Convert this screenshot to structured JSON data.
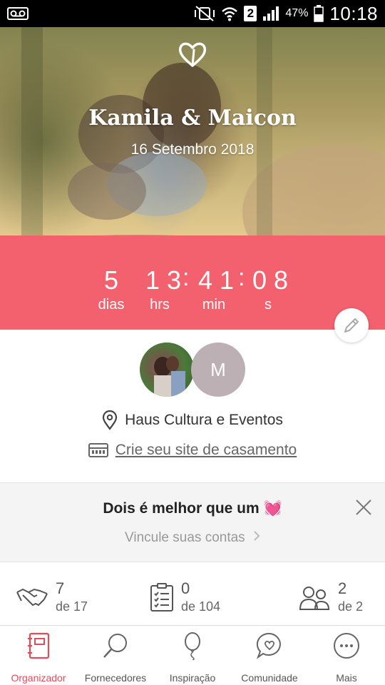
{
  "status_bar": {
    "battery": "47%",
    "sim": "2",
    "time": "10:18",
    "icons": [
      "voicemail-icon",
      "vibrate-off-icon",
      "wifi-icon",
      "signal-icon",
      "battery-icon"
    ]
  },
  "hero": {
    "names": "Kamila & Maicon",
    "date": "16 Setembro 2018",
    "heart_icon": "heart-outline-icon"
  },
  "countdown": {
    "days": "5",
    "hours": "13",
    "minutes": "41",
    "seconds": "08",
    "separator": ":",
    "labels": {
      "days": "dias",
      "hours": "hrs",
      "minutes": "min",
      "seconds": "s"
    },
    "color": "#f2616d"
  },
  "couple": {
    "avatar_letter": "M",
    "venue": "Haus Cultura e Eventos",
    "site_link": "Crie seu site de casamento"
  },
  "promo": {
    "title": "Dois é melhor que um 💓",
    "link": "Vincule suas contas"
  },
  "stats": [
    {
      "icon": "handshake-icon",
      "value": "7",
      "total": "de 17"
    },
    {
      "icon": "checklist-icon",
      "value": "0",
      "total": "de 104"
    },
    {
      "icon": "guests-icon",
      "value": "2",
      "total": "de 2"
    }
  ],
  "nav": {
    "items": [
      {
        "label": "Organizador",
        "icon": "organizer-icon",
        "active": true
      },
      {
        "label": "Fornecedores",
        "icon": "search-icon",
        "active": false
      },
      {
        "label": "Inspiração",
        "icon": "balloon-icon",
        "active": false
      },
      {
        "label": "Comunidade",
        "icon": "chat-heart-icon",
        "active": false
      },
      {
        "label": "Mais",
        "icon": "more-icon",
        "active": false
      }
    ],
    "active_color": "#e24c5a"
  }
}
